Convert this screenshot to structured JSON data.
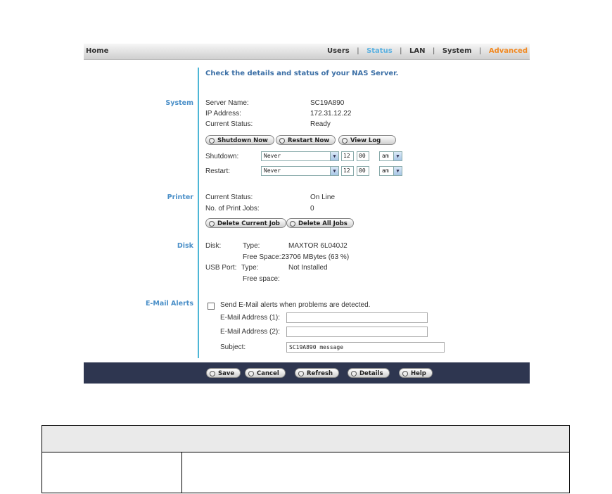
{
  "topbar": {
    "home": "Home",
    "nav": [
      "Users",
      "Status",
      "LAN",
      "System",
      "Advanced"
    ],
    "separator": "|",
    "active_tab": "Status",
    "colors": {
      "active": "#5ab0e0",
      "advanced": "#f08a24",
      "bar": "#cfcfcf"
    }
  },
  "intro": "Check the details and status of your NAS Server.",
  "sections": {
    "system": "System",
    "printer": "Printer",
    "disk": "Disk",
    "email": "E-Mail Alerts"
  },
  "system": {
    "server_name_label": "Server Name:",
    "server_name": "SC19A890",
    "ip_label": "IP Address:",
    "ip": "172.31.12.22",
    "status_label": "Current Status:",
    "status": "Ready",
    "buttons": {
      "shutdown": "Shutdown Now",
      "restart": "Restart Now",
      "viewlog": "View Log"
    },
    "shutdown_label": "Shutdown:",
    "restart_label": "Restart:",
    "shutdown_sched": {
      "mode": "Never",
      "hour": "12",
      "minute": "00",
      "ampm": "am"
    },
    "restart_sched": {
      "mode": "Never",
      "hour": "12",
      "minute": "00",
      "ampm": "am"
    }
  },
  "printer": {
    "status_label": "Current Status:",
    "status": "On Line",
    "jobs_label": "No. of Print Jobs:",
    "jobs": "0",
    "buttons": {
      "delete_current": "Delete Current Job",
      "delete_all": "Delete All Jobs"
    }
  },
  "disk": {
    "disk_label": "Disk:",
    "type_label": "Type:",
    "type": "MAXTOR 6L040J2",
    "free_label": "Free Space:",
    "free": "23706 MBytes (63 %)",
    "usb_label": "USB Port:",
    "usb_type_label": "Type:",
    "usb_type": "Not Installed",
    "usb_free_label": "Free space:"
  },
  "email": {
    "checkbox_label": "Send E-Mail alerts when problems are detected.",
    "addr1_label": "E-Mail Address (1):",
    "addr2_label": "E-Mail Address (2):",
    "subject_label": "Subject:",
    "addr1": "",
    "addr2": "",
    "subject": "SC19A890 message"
  },
  "bottom_buttons": {
    "save": "Save",
    "cancel": "Cancel",
    "refresh": "Refresh",
    "details": "Details",
    "help": "Help"
  },
  "colors": {
    "accent_line": "#4db6d6",
    "section_label": "#4a8fc8",
    "intro": "#3a6ea5",
    "footer_bar": "#2e3650"
  }
}
